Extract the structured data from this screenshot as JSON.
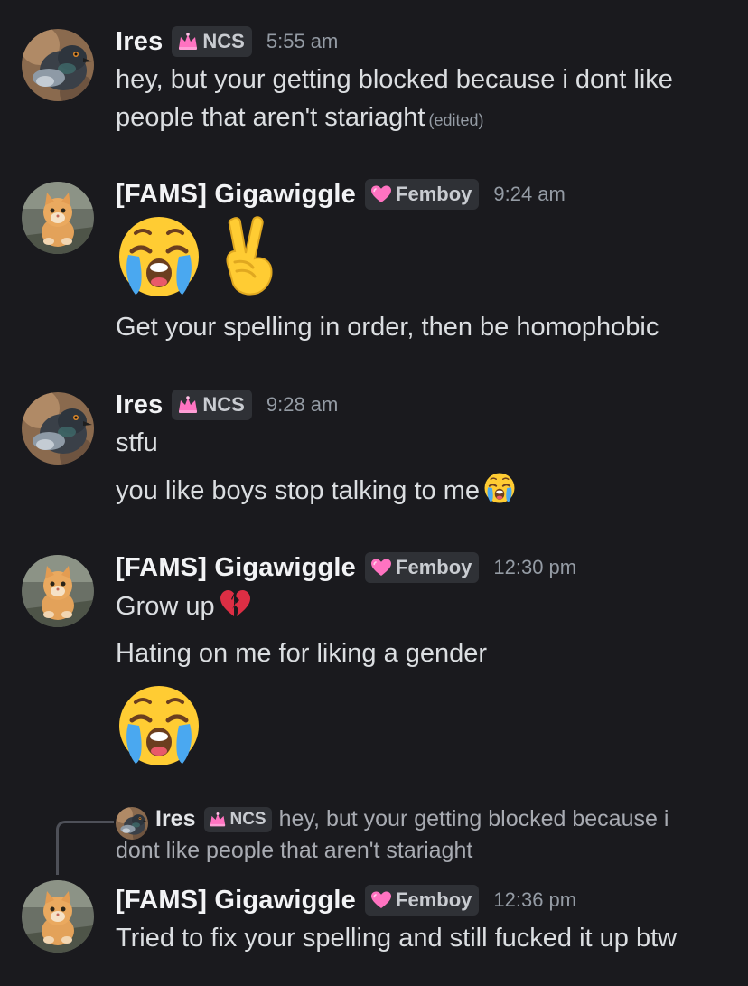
{
  "messages": [
    {
      "author": "Ires",
      "role_tag": "NCS",
      "role_icon": "pink-crown-icon",
      "avatar": "pigeon-avatar",
      "time": "5:55 am",
      "lines": [
        "hey, but your getting blocked because i dont like",
        "people that aren't stariaght"
      ],
      "edited_label": "(edited)"
    },
    {
      "author": "[FAMS] Gigawiggle",
      "role_tag": "Femboy",
      "role_icon": "pink-heart-icon",
      "avatar": "kitten-avatar",
      "time": "9:24 am",
      "big_emojis": [
        "loudly-crying-face",
        "victory-hand"
      ],
      "lines": [
        "Get your spelling in order, then be homophobic"
      ]
    },
    {
      "author": "Ires",
      "role_tag": "NCS",
      "role_icon": "pink-crown-icon",
      "avatar": "pigeon-avatar",
      "time": "9:28 am",
      "lines": [
        "stfu",
        "you like boys stop talking to me"
      ],
      "inline_emoji": "loudly-crying-face"
    },
    {
      "author": "[FAMS] Gigawiggle",
      "role_tag": "Femboy",
      "role_icon": "pink-heart-icon",
      "avatar": "kitten-avatar",
      "time": "12:30 pm",
      "lines": [
        "Grow up",
        "Hating on me for liking a gender"
      ],
      "inline_emoji": "broken-heart",
      "big_emojis": [
        "loudly-crying-face"
      ]
    },
    {
      "author": "[FAMS] Gigawiggle",
      "role_tag": "Femboy",
      "role_icon": "pink-heart-icon",
      "avatar": "kitten-avatar",
      "time": "12:36 pm",
      "reply": {
        "author": "Ires",
        "role_tag": "NCS",
        "text_line1": "hey, but your getting blocked because i",
        "text_line2": "dont like people that aren't stariaght"
      },
      "lines": [
        "Tried to fix your spelling and still fucked it up btw"
      ]
    }
  ],
  "colors": {
    "background": "#1a1a1e",
    "username": "#f2f3f5",
    "text": "#dbdee1",
    "muted": "#949ba4",
    "tag_bg": "#2f3136",
    "pink": "#ff73c1"
  }
}
